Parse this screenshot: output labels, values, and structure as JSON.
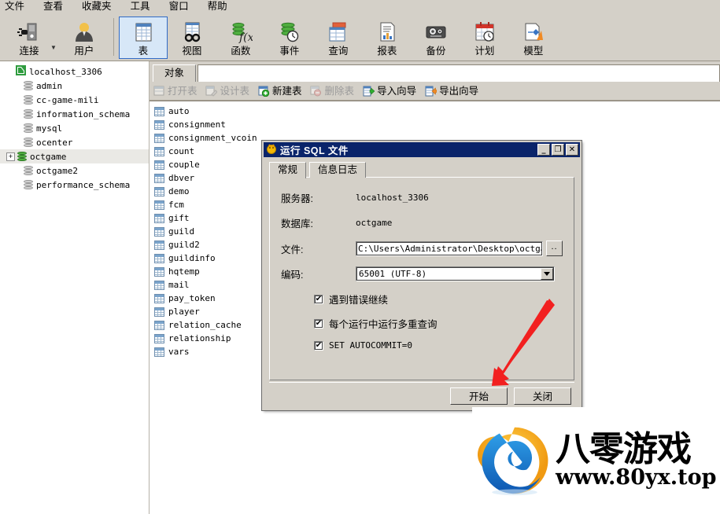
{
  "menubar": {
    "items": [
      {
        "label": "文件"
      },
      {
        "label": "查看"
      },
      {
        "label": "收藏夹"
      },
      {
        "label": "工具"
      },
      {
        "label": "窗口"
      },
      {
        "label": "帮助"
      }
    ]
  },
  "toolbar": {
    "items": [
      {
        "label": "连接",
        "icon": "connection-icon",
        "selected": false,
        "dropdown": true
      },
      {
        "label": "用户",
        "icon": "user-icon",
        "selected": false
      },
      {
        "label": "表",
        "icon": "table-icon",
        "selected": true
      },
      {
        "label": "视图",
        "icon": "view-icon",
        "selected": false
      },
      {
        "label": "函数",
        "icon": "function-icon",
        "selected": false
      },
      {
        "label": "事件",
        "icon": "event-icon",
        "selected": false
      },
      {
        "label": "查询",
        "icon": "query-icon",
        "selected": false
      },
      {
        "label": "报表",
        "icon": "report-icon",
        "selected": false
      },
      {
        "label": "备份",
        "icon": "backup-icon",
        "selected": false
      },
      {
        "label": "计划",
        "icon": "schedule-icon",
        "selected": false
      },
      {
        "label": "模型",
        "icon": "model-icon",
        "selected": false
      }
    ]
  },
  "tree": {
    "root": {
      "label": "localhost_3306",
      "icon": "navicat-connection-icon"
    },
    "databases": [
      {
        "label": "admin",
        "selected": false,
        "expandable": false
      },
      {
        "label": "cc-game-mili",
        "selected": false,
        "expandable": false
      },
      {
        "label": "information_schema",
        "selected": false,
        "expandable": false
      },
      {
        "label": "mysql",
        "selected": false,
        "expandable": false
      },
      {
        "label": "ocenter",
        "selected": false,
        "expandable": false
      },
      {
        "label": "octgame",
        "selected": true,
        "expandable": true,
        "expander": "+"
      },
      {
        "label": "octgame2",
        "selected": false,
        "expandable": false
      },
      {
        "label": "performance_schema",
        "selected": false,
        "expandable": false
      }
    ]
  },
  "object_tabs": {
    "tabs": [
      {
        "label": "对象",
        "active": true
      }
    ]
  },
  "action_toolbar": {
    "actions": [
      {
        "label": "打开表",
        "icon": "open-table-icon",
        "enabled": false
      },
      {
        "label": "设计表",
        "icon": "design-table-icon",
        "enabled": false
      },
      {
        "label": "新建表",
        "icon": "new-table-icon",
        "enabled": true
      },
      {
        "label": "删除表",
        "icon": "delete-table-icon",
        "enabled": false
      },
      {
        "label": "导入向导",
        "icon": "import-wizard-icon",
        "enabled": true
      },
      {
        "label": "导出向导",
        "icon": "export-wizard-icon",
        "enabled": true
      }
    ]
  },
  "table_list": {
    "tables": [
      {
        "name": "auto"
      },
      {
        "name": "consignment"
      },
      {
        "name": "consignment_vcoin"
      },
      {
        "name": "count"
      },
      {
        "name": "couple"
      },
      {
        "name": "dbver"
      },
      {
        "name": "demo"
      },
      {
        "name": "fcm"
      },
      {
        "name": "gift"
      },
      {
        "name": "guild"
      },
      {
        "name": "guild2"
      },
      {
        "name": "guildinfo"
      },
      {
        "name": "hqtemp"
      },
      {
        "name": "mail"
      },
      {
        "name": "pay_token"
      },
      {
        "name": "player"
      },
      {
        "name": "relation_cache"
      },
      {
        "name": "relationship"
      },
      {
        "name": "vars"
      }
    ]
  },
  "dialog": {
    "title": "运行 SQL 文件",
    "window_buttons": {
      "minimize": "_",
      "maximize": "❐",
      "close": "✕"
    },
    "tabs": [
      {
        "label": "常规",
        "active": true
      },
      {
        "label": "信息日志",
        "active": false
      }
    ],
    "fields": {
      "server_label": "服务器:",
      "server_value": "localhost_3306",
      "database_label": "数据库:",
      "database_value": "octgame",
      "file_label": "文件:",
      "file_value": "C:\\Users\\Administrator\\Desktop\\octgame.sq",
      "browse_label": "..",
      "encoding_label": "编码:",
      "encoding_value": "65001  (UTF-8)"
    },
    "checkboxes": [
      {
        "label": "遇到错误继续",
        "checked": true,
        "mark": "✔"
      },
      {
        "label": "每个运行中运行多重查询",
        "checked": true,
        "mark": "✔"
      },
      {
        "label": "SET AUTOCOMMIT=0",
        "checked": true,
        "mark": "✔",
        "mono": true
      }
    ],
    "buttons": [
      {
        "label": "开始",
        "name": "start-button"
      },
      {
        "label": "关闭",
        "name": "close-button"
      }
    ]
  },
  "annotation": {
    "arrow_color": "#f22020",
    "points_to": "开始"
  },
  "watermark": {
    "title": "八零游戏",
    "url": "www.80yx.top",
    "logo_colors": {
      "orange": "#f5a623",
      "blue": "#1a7fd4",
      "deep_blue": "#0e55a8"
    }
  }
}
